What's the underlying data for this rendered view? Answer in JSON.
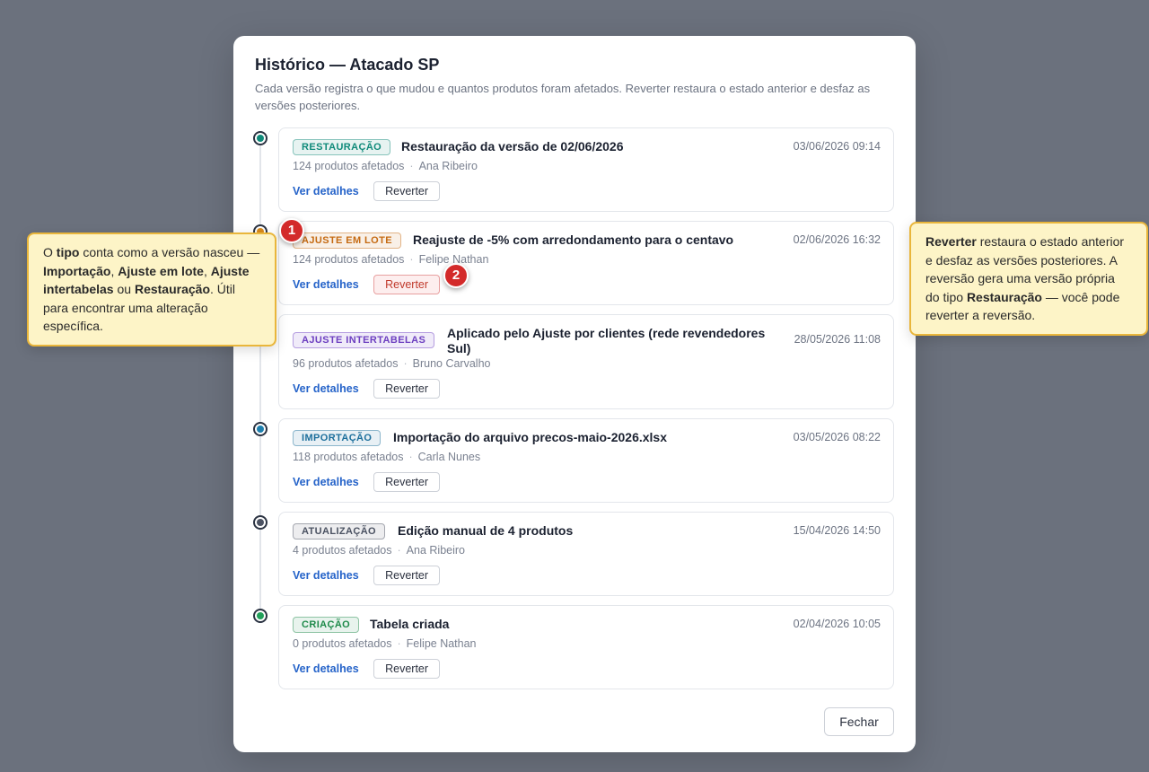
{
  "modal": {
    "title": "Histórico — Atacado SP",
    "subtitle": "Cada versão registra o que mudou e quantos produtos foram afetados. Reverter restaura o estado anterior e desfaz as versões posteriores.",
    "close_label": "Fechar"
  },
  "versions": [
    {
      "badge": "RESTAURAÇÃO",
      "badge_color": "#0f8a7a",
      "title": "Restauração da versão de 02/06/2026",
      "date": "03/06/2026 09:14",
      "products": "124 produtos afetados",
      "author": "Ana Ribeiro",
      "details_label": "Ver detalhes",
      "revert_label": "Reverter",
      "dot_color": "#0f8a7a"
    },
    {
      "badge": "AJUSTE EM LOTE",
      "badge_color": "#c56a12",
      "title": "Reajuste de -5% com arredondamento para o centavo",
      "date": "02/06/2026 16:32",
      "products": "124 produtos afetados",
      "author": "Felipe Nathan",
      "details_label": "Ver detalhes",
      "revert_label": "Reverter",
      "dot_color": "#d98a1c"
    },
    {
      "badge": "AJUSTE INTERTABELAS",
      "badge_color": "#6d3fc0",
      "title": "Aplicado pelo Ajuste por clientes (rede revendedores Sul)",
      "date": "28/05/2026 11:08",
      "products": "96 produtos afetados",
      "author": "Bruno Carvalho",
      "details_label": "Ver detalhes",
      "revert_label": "Reverter",
      "dot_color": "#7c4dd0"
    },
    {
      "badge": "IMPORTAÇÃO",
      "badge_color": "#1d6f9c",
      "title": "Importação do arquivo precos-maio-2026.xlsx",
      "date": "03/05/2026 08:22",
      "products": "118 produtos afetados",
      "author": "Carla Nunes",
      "details_label": "Ver detalhes",
      "revert_label": "Reverter",
      "dot_color": "#1d7fae"
    },
    {
      "badge": "ATUALIZAÇÃO",
      "badge_color": "#4b5262",
      "title": "Edição manual de 4 produtos",
      "date": "15/04/2026 14:50",
      "products": "4 produtos afetados",
      "author": "Ana Ribeiro",
      "details_label": "Ver detalhes",
      "revert_label": "Reverter",
      "dot_color": "#4b5262"
    },
    {
      "badge": "CRIAÇÃO",
      "badge_color": "#1e8a4a",
      "title": "Tabela criada",
      "date": "02/04/2026 10:05",
      "products": "0 produtos afetados",
      "author": "Felipe Nathan",
      "details_label": "Ver detalhes",
      "revert_label": "Reverter",
      "dot_color": "#22a05a"
    }
  ],
  "callouts": {
    "left": {
      "marker": "1",
      "t1": "O ",
      "b1": "tipo",
      "t2": " conta como a versão nasceu — ",
      "b2": "Importação",
      "t3": ", ",
      "b3": "Ajuste em lote",
      "t4": ", ",
      "b4": "Ajuste intertabelas",
      "t5": " ou ",
      "b5": "Restauração",
      "t6": ". Útil para encontrar uma alteração específica."
    },
    "right": {
      "marker": "2",
      "b1": "Reverter",
      "t1": " restaura o estado anterior e desfaz as versões posteriores. A reversão gera uma versão própria do tipo ",
      "b2": "Restauração",
      "t2": " — você pode reverter a reversão."
    }
  }
}
